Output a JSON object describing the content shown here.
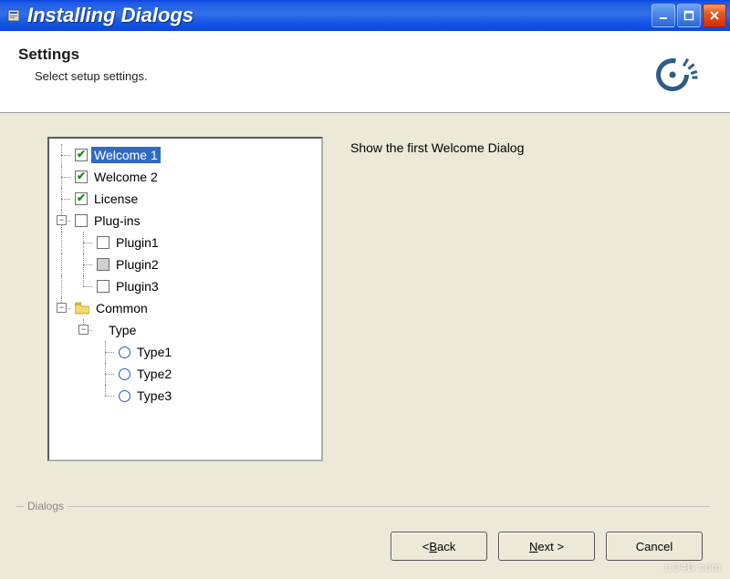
{
  "window": {
    "title": "Installing Dialogs"
  },
  "header": {
    "title": "Settings",
    "subtitle": "Select setup settings."
  },
  "description": "Show the first Welcome Dialog",
  "tree": {
    "welcome1": "Welcome 1",
    "welcome2": "Welcome 2",
    "license": "License",
    "plugins": "Plug-ins",
    "plugin1": "Plugin1",
    "plugin2": "Plugin2",
    "plugin3": "Plugin3",
    "common": "Common",
    "type": "Type",
    "type1": "Type1",
    "type2": "Type2",
    "type3": "Type3"
  },
  "buttons": {
    "back_prefix": "< ",
    "back_u": "B",
    "back_suffix": "ack",
    "next_u": "N",
    "next_suffix": "ext >",
    "cancel": "Cancel"
  },
  "fieldset_label": "Dialogs",
  "watermark": "LO4D.com"
}
